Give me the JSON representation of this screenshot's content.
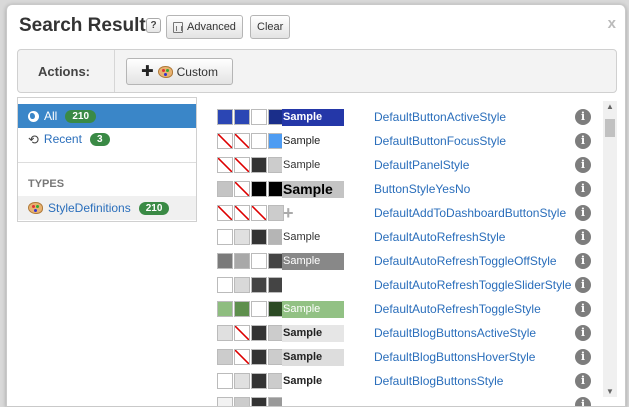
{
  "header": {
    "title": "Search Results",
    "help_label": "?",
    "advanced_label": "Advanced",
    "clear_label": "Clear",
    "close_label": "x"
  },
  "actions": {
    "label": "Actions:",
    "custom_label": "Custom"
  },
  "sidebar": {
    "all": {
      "label": "All",
      "count": "210"
    },
    "recent": {
      "label": "Recent",
      "count": "3"
    },
    "types_label": "TYPES",
    "types": [
      {
        "label": "StyleDefinitions",
        "count": "210"
      }
    ]
  },
  "results": [
    {
      "name": "DefaultButtonActiveStyle",
      "swatches": [
        "#2b46b4",
        "#2b46b4",
        "#ffffff",
        "#1a2e8a"
      ],
      "sample": "Sample",
      "sample_bg": "#2437a8",
      "sample_color": "#ffffff",
      "sample_bold": true
    },
    {
      "name": "DefaultButtonFocusStyle",
      "swatches": [
        "slash",
        "slash",
        "#ffffff",
        "#4e9cf2"
      ],
      "sample": "Sample",
      "sample_bg": "#ffffff",
      "sample_color": "#222222",
      "sample_bold": false
    },
    {
      "name": "DefaultPanelStyle",
      "swatches": [
        "slash",
        "slash",
        "#333333",
        "#cccccc"
      ],
      "sample": "Sample",
      "sample_bg": "#ffffff",
      "sample_color": "#333333",
      "sample_bold": false
    },
    {
      "name": "ButtonStyleYesNo",
      "swatches": [
        "#c4c4c4",
        "slash",
        "#000000",
        "#000000"
      ],
      "sample": "Sample",
      "sample_bg": "#c4c4c4",
      "sample_color": "#000000",
      "sample_bold": true,
      "sample_large": true
    },
    {
      "name": "DefaultAddToDashboardButtonStyle",
      "swatches": [
        "slash",
        "slash",
        "slash",
        "#cccccc"
      ],
      "sample": "",
      "plus": "+"
    },
    {
      "name": "DefaultAutoRefreshStyle",
      "swatches": [
        "#ffffff",
        "#e0e0e0",
        "#333333",
        "#b5b5b5"
      ],
      "sample": "Sample",
      "sample_bg": "#ffffff",
      "sample_color": "#333333",
      "sample_bold": false
    },
    {
      "name": "DefaultAutoRefreshToggleOffStyle",
      "swatches": [
        "#7a7a7a",
        "#a8a8a8",
        "#ffffff",
        "#444444"
      ],
      "sample": "Sample",
      "sample_bg": "#888888",
      "sample_color": "#ffffff",
      "sample_bold": false
    },
    {
      "name": "DefaultAutoRefreshToggleSliderStyle",
      "swatches": [
        "#ffffff",
        "#d9d9d9",
        "#444444",
        "#444444"
      ],
      "sample": "",
      "sample_bg": "#ffffff"
    },
    {
      "name": "DefaultAutoRefreshToggleStyle",
      "swatches": [
        "#8ebd7f",
        "#5e8f4d",
        "#ffffff",
        "#2c4a24"
      ],
      "sample": "Sample",
      "sample_bg": "#92c184",
      "sample_color": "#ffffff",
      "sample_bold": false
    },
    {
      "name": "DefaultBlogButtonsActiveStyle",
      "swatches": [
        "#e0e0e0",
        "slash",
        "#333333",
        "#cccccc"
      ],
      "sample": "Sample",
      "sample_bg": "#e6e6e6",
      "sample_color": "#222222",
      "sample_bold": true
    },
    {
      "name": "DefaultBlogButtonsHoverStyle",
      "swatches": [
        "#cccccc",
        "slash",
        "#333333",
        "#cccccc"
      ],
      "sample": "Sample",
      "sample_bg": "#dddddd",
      "sample_color": "#222222",
      "sample_bold": true
    },
    {
      "name": "DefaultBlogButtonsStyle",
      "swatches": [
        "#ffffff",
        "#e0e0e0",
        "#333333",
        "#cccccc"
      ],
      "sample": "Sample",
      "sample_bg": "#ffffff",
      "sample_color": "#222222",
      "sample_bold": true
    },
    {
      "name": "",
      "swatches": [
        "#f2f2f2",
        "#cccccc",
        "#333333",
        "#999999"
      ],
      "sample": "",
      "sample_bg": "#ffffff"
    }
  ]
}
